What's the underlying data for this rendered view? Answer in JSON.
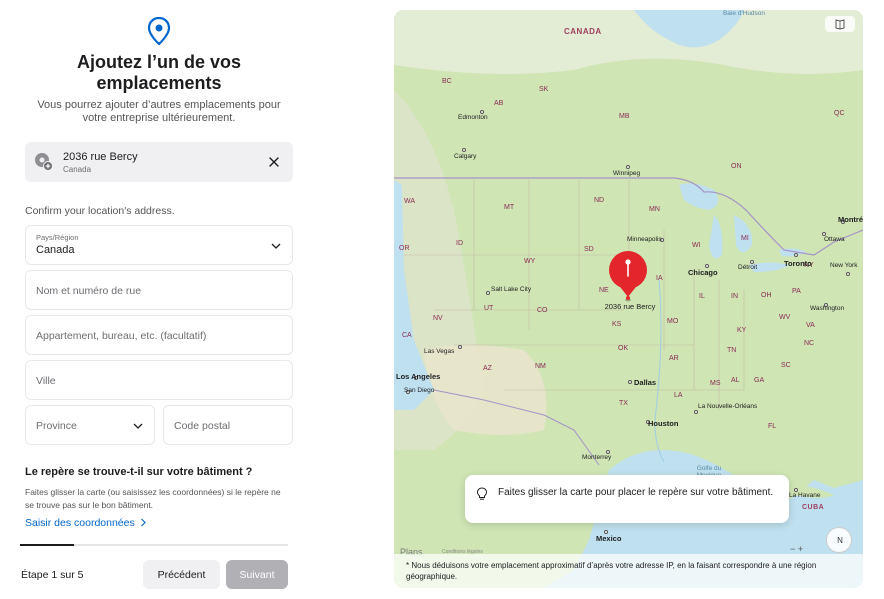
{
  "colors": {
    "accent": "#0066cc",
    "marker": "#e3262b",
    "next_disabled": "#b0b0b5",
    "progress": "#1d1d1f"
  },
  "header": {
    "title": "Ajoutez l’un de vos emplacements",
    "subtitle": "Vous pourrez ajouter d’autres emplacements pour votre entreprise ultérieurement."
  },
  "selected_address": {
    "line": "2036 rue Bercy",
    "country": "Canada"
  },
  "confirm_label": "Confirm your location's address.",
  "form": {
    "country_label": "Pays/Région",
    "country_value": "Canada",
    "street_placeholder": "Nom et numéro de rue",
    "apt_placeholder": "Appartement, bureau, etc. (facultatif)",
    "city_placeholder": "Ville",
    "province_placeholder": "Province",
    "postal_placeholder": "Code postal"
  },
  "question": {
    "title": "Le repère se trouve-t-il sur votre bâtiment ?",
    "text": "Faites glisser la carte (ou saisissez les coordonnées) si le repère ne se trouve pas sur le bon bâtiment.",
    "link": "Saisir des coordonnées"
  },
  "progress": {
    "fraction": 0.2
  },
  "footer": {
    "step": "Étape 1 sur 5",
    "prev": "Précédent",
    "next": "Suivant"
  },
  "map": {
    "marker_label": "2036 rue Bercy",
    "tooltip": "Faites glisser la carte pour placer le repère sur votre bâtiment.",
    "footnote": "* Nous déduisons votre emplacement approximatif d’après votre adresse IP, en la faisant correspondre à une région géographique.",
    "attribution": "Plans",
    "legal": "Conditions légales",
    "compass": "N",
    "zoom": "−  +",
    "countries": {
      "canada": "CANADA",
      "mexico": "Mexico",
      "cuba": "CUBA"
    },
    "regions": [
      "BC",
      "AB",
      "SK",
      "MB",
      "ON",
      "QC",
      "WA",
      "MT",
      "ND",
      "MN",
      "OR",
      "ID",
      "WY",
      "SD",
      "WI",
      "MI",
      "NY",
      "NE",
      "IA",
      "IL",
      "IN",
      "OH",
      "PA",
      "NV",
      "UT",
      "CO",
      "KS",
      "MO",
      "KY",
      "WV",
      "VA",
      "CA",
      "AZ",
      "NM",
      "OK",
      "AR",
      "TN",
      "NC",
      "SC",
      "TX",
      "LA",
      "MS",
      "AL",
      "GA",
      "FL"
    ],
    "cities": {
      "edmonton": "Edmonton",
      "calgary": "Calgary",
      "winnipeg": "Winnipeg",
      "minneapolis": "Minneapolis",
      "chicago": "Chicago",
      "detroit": "Détroit",
      "toronto": "Toronto",
      "montreal": "Montréal",
      "ottawa": "Ottawa",
      "new_york": "New York",
      "washington": "Washington",
      "salt_lake": "Salt Lake City",
      "las_vegas": "Las Vegas",
      "los_angeles": "Los Angeles",
      "san_diego": "San Diego",
      "dallas": "Dallas",
      "houston": "Houston",
      "new_orleans": "La Nouvelle-Orléans",
      "monterrey": "Monterrey",
      "havana": "La Havane",
      "mexico_city": "Mexico",
      "hudson": "Baie d'Hudson",
      "gulf": "Golfe du Mexique"
    }
  }
}
